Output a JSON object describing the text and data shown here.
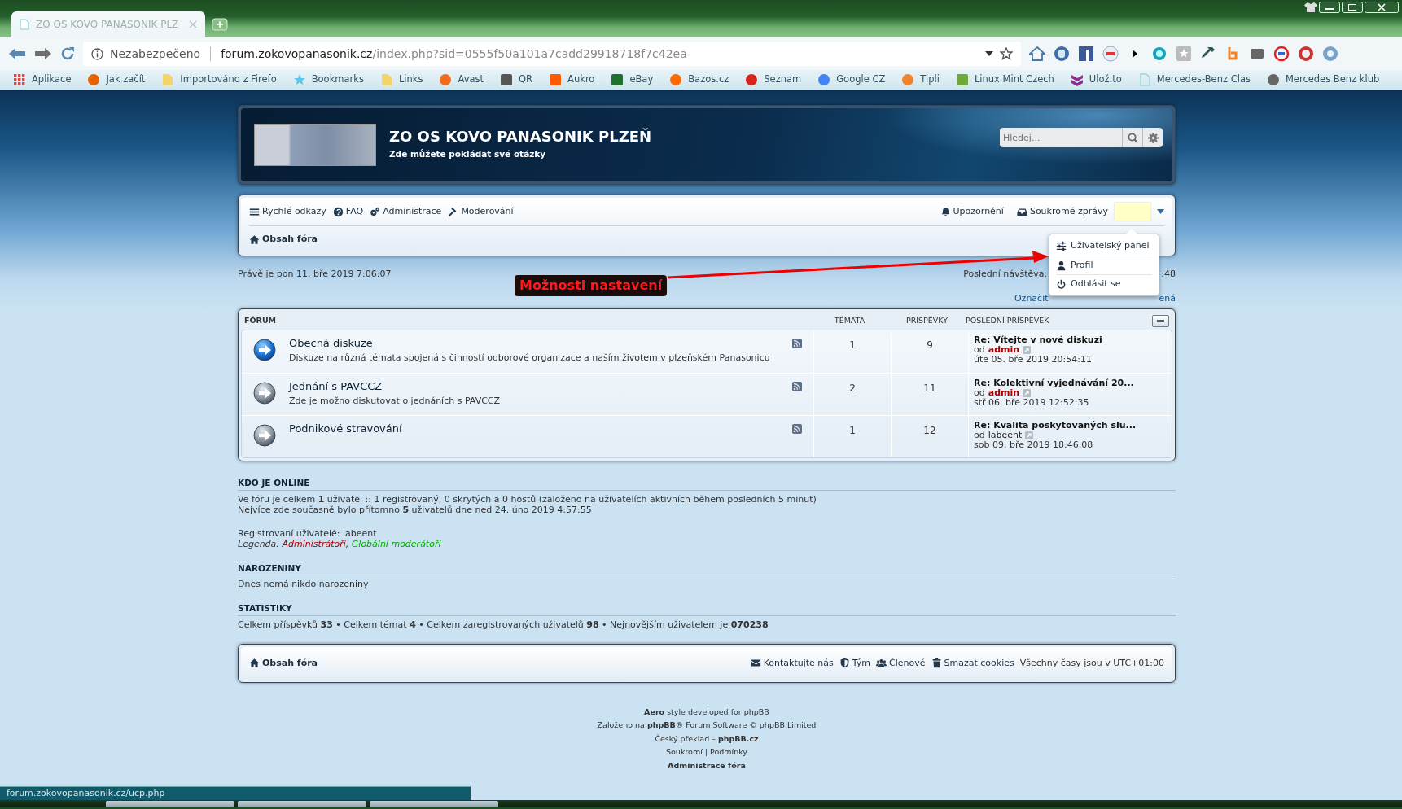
{
  "browser": {
    "tab_title": "ZO OS KOVO PANASONIK PLZ",
    "security_label": "Nezabezpečeno",
    "url_domain": "forum.zokovopanasonik.cz",
    "url_path": "/index.php?sid=0555f50a101a7cadd29918718f7c42ea",
    "bookmarks": [
      {
        "label": "Aplikace",
        "kind": "apps",
        "color": "#e8453c"
      },
      {
        "label": "Jak začít",
        "kind": "circle",
        "color": "#e66000"
      },
      {
        "label": "Importováno z Firefo",
        "kind": "folder",
        "color": "#f3d36b"
      },
      {
        "label": "Bookmarks",
        "kind": "star",
        "color": "#5bc8e8"
      },
      {
        "label": "Links",
        "kind": "folder",
        "color": "#f3d36b"
      },
      {
        "label": "Avast",
        "kind": "circle",
        "color": "#f26b1d"
      },
      {
        "label": "QR",
        "kind": "square",
        "color": "#555555"
      },
      {
        "label": "Aukro",
        "kind": "square",
        "color": "#ff5a00"
      },
      {
        "label": "eBay",
        "kind": "square",
        "color": "#1f6f2f"
      },
      {
        "label": "Bazos.cz",
        "kind": "circle",
        "color": "#ff6a00"
      },
      {
        "label": "Seznam",
        "kind": "circle",
        "color": "#d9241b"
      },
      {
        "label": "Google CZ",
        "kind": "circle",
        "color": "#4285f4"
      },
      {
        "label": "Tipli",
        "kind": "circle",
        "color": "#f0832a"
      },
      {
        "label": "Linux Mint Czech",
        "kind": "square",
        "color": "#6fa83a"
      },
      {
        "label": "Ulož.to",
        "kind": "chevron",
        "color": "#8e2d8f"
      },
      {
        "label": "Mercedes-Benz Clas",
        "kind": "page",
        "color": "#9fd3e0"
      },
      {
        "label": "Mercedes Benz klub",
        "kind": "circle",
        "color": "#666666"
      }
    ],
    "status_url": "forum.zokovopanasonik.cz/ucp.php"
  },
  "site": {
    "title": "ZO OS KOVO PANASONIK PLZEŇ",
    "subtitle": "Zde můžete pokládat své otázky",
    "search": {
      "placeholder": "Hledej..."
    }
  },
  "navbar": {
    "left_links": [
      {
        "label": "Rychlé odkazy",
        "kind": "menu"
      },
      {
        "label": "FAQ",
        "kind": "help"
      },
      {
        "label": "Administrace",
        "kind": "gears"
      },
      {
        "label": "Moderování",
        "kind": "gavel"
      }
    ],
    "right_links": [
      {
        "label": "Upozornění",
        "kind": "bell"
      },
      {
        "label": "Soukromé zprávy",
        "kind": "inbox"
      }
    ],
    "breadcrumb": "Obsah fóra",
    "user_menu": {
      "expanded": true,
      "items": [
        {
          "label": "Uživatelský panel",
          "kind": "sliders"
        },
        {
          "label": "Profil",
          "kind": "user"
        },
        {
          "label": "Odhlásit se",
          "kind": "power"
        }
      ]
    }
  },
  "current_time": "Právě je pon 11. bře 2019 7:06:07",
  "last_visit_start": "Poslední návštěva:",
  "last_visit_end": ":48",
  "mark_read_start": "Označit",
  "mark_read_end": "ená",
  "annotation": "Možnosti nastavení",
  "forum_table": {
    "columns": [
      "FÓRUM",
      "TÉMATA",
      "PŘÍSPĚVKY",
      "POSLEDNÍ PŘÍSPĚVEK"
    ],
    "rows": [
      {
        "title": "Obecná diskuze",
        "description": "Diskuze na různá témata spojená s činností odborové organizace a naším životem v plzeňském Panasonicu",
        "unread": true,
        "topics": "1",
        "posts": "9",
        "last_post": {
          "title": "Re: Vítejte v nové diskuzi",
          "by": "od",
          "author": "admin",
          "author_is_admin": true,
          "date": "úte 05. bře 2019 20:54:11"
        }
      },
      {
        "title": "Jednání s PAVCCZ",
        "description": "Zde je možno diskutovat o jednáních s PAVCCZ",
        "unread": false,
        "topics": "2",
        "posts": "11",
        "last_post": {
          "title": "Re: Kolektivní vyjednávání 20...",
          "by": "od",
          "author": "admin",
          "author_is_admin": true,
          "date": "stř 06. bře 2019 12:52:35"
        }
      },
      {
        "title": "Podnikové stravování",
        "unread": false,
        "topics": "1",
        "posts": "12",
        "last_post": {
          "title": "Re: Kvalita poskytovaných slu...",
          "by": "od",
          "author": "labeent",
          "author_is_admin": false,
          "date": "sob 09. bře 2019 18:46:08"
        }
      }
    ]
  },
  "online": {
    "heading": "KDO JE ONLINE",
    "lines": [
      "Ve fóru je celkem **1** uživatel :: 1 registrovaný, 0 skrytých a 0 hostů (založeno na uživatelích aktivních během posledních 5 minut)",
      "Nejvíce zde současně bylo přítomno **5** uživatelů dne ned 24. úno 2019 4:57:55"
    ],
    "registered": "Registrovaní uživatelé: labeent",
    "legend": {
      "label": "Legenda:",
      "separator": ",",
      "groups": [
        {
          "label": "Administrátoři",
          "color": "#aa0000"
        },
        {
          "label": "Globální moderátoři",
          "color": "#00aa00"
        }
      ]
    }
  },
  "birthdays": {
    "heading": "NAROZENINY",
    "text": "Dnes nemá nikdo narozeniny"
  },
  "statistics": {
    "heading": "STATISTIKY",
    "text": "Celkem příspěvků **33** • Celkem témat **4** • Celkem zaregistrovaných uživatelů **98** • Nejnovějším uživatelem je **070238**"
  },
  "footer_nav": {
    "breadcrumb": "Obsah fóra",
    "links": [
      {
        "label": "Kontaktujte nás",
        "kind": "envelope"
      },
      {
        "label": "Tým",
        "kind": "shield"
      },
      {
        "label": "Členové",
        "kind": "users"
      },
      {
        "label": "Smazat cookies",
        "kind": "trash"
      }
    ],
    "timezone": "Všechny časy jsou v UTC+01:00"
  },
  "credits": [
    "**Aero** style developed for phpBB",
    "Založeno na **phpBB**® Forum Software © phpBB Limited",
    "Český překlad – **phpBB.cz**",
    "Soukromí | Podmínky",
    "**Administrace fóra**"
  ]
}
